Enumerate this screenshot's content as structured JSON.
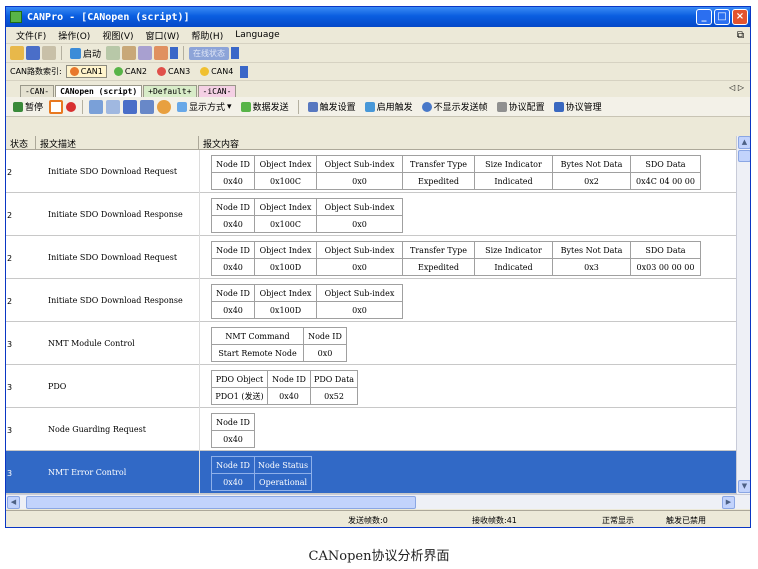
{
  "window": {
    "title": "CANPro - [CANopen (script)]"
  },
  "menu": [
    "文件(F)",
    "操作(O)",
    "视图(V)",
    "窗口(W)",
    "帮助(H)",
    "Language"
  ],
  "toolbar": {
    "start_label": "启动",
    "online_status_label": "在线状态"
  },
  "channels": {
    "label": "CAN路数索引:",
    "items": [
      {
        "name": "CAN1",
        "color": "#e8782c",
        "active": true
      },
      {
        "name": "CAN2",
        "color": "#58b448",
        "active": false
      },
      {
        "name": "CAN3",
        "color": "#e0504a",
        "active": false
      },
      {
        "name": "CAN4",
        "color": "#f0c030",
        "active": false
      }
    ]
  },
  "tabs": [
    {
      "label": "-CAN-",
      "style": "plain"
    },
    {
      "label": "CANopen (script)",
      "style": "active"
    },
    {
      "label": "+Default+",
      "style": "green"
    },
    {
      "label": "-iCAN-",
      "style": "pink"
    }
  ],
  "proto_toolbar": {
    "pause_label": "暂停",
    "display_mode_label": "显示方式",
    "send_data_label": "数据发送",
    "trigger_settings_label": "触发设置",
    "enable_trigger_label": "启用触发",
    "hide_sent_label": "不显示发送帧",
    "protocol_config_label": "协议配置",
    "protocol_manage_label": "协议管理"
  },
  "grid": {
    "headers": [
      "状态",
      "报文描述",
      "报文内容"
    ],
    "rows": [
      {
        "state": "2",
        "desc": "Initiate SDO Download Request",
        "selected": false,
        "cols": [
          "Node ID",
          "Object Index",
          "Object Sub-index",
          "Transfer Type",
          "Size Indicator",
          "Bytes Not Data",
          "SDO Data"
        ],
        "vals": [
          "0x40",
          "0x100C",
          "0x0",
          "Expedited",
          "Indicated",
          "0x2",
          "0x4C 04 00 00"
        ]
      },
      {
        "state": "2",
        "desc": "Initiate SDO Download Response",
        "selected": false,
        "cols": [
          "Node ID",
          "Object Index",
          "Object Sub-index"
        ],
        "vals": [
          "0x40",
          "0x100C",
          "0x0"
        ]
      },
      {
        "state": "2",
        "desc": "Initiate SDO Download Request",
        "selected": false,
        "cols": [
          "Node ID",
          "Object Index",
          "Object Sub-index",
          "Transfer Type",
          "Size Indicator",
          "Bytes Not Data",
          "SDO Data"
        ],
        "vals": [
          "0x40",
          "0x100D",
          "0x0",
          "Expedited",
          "Indicated",
          "0x3",
          "0x03 00 00 00"
        ]
      },
      {
        "state": "2",
        "desc": "Initiate SDO Download Response",
        "selected": false,
        "cols": [
          "Node ID",
          "Object Index",
          "Object Sub-index"
        ],
        "vals": [
          "0x40",
          "0x100D",
          "0x0"
        ]
      },
      {
        "state": "3",
        "desc": "NMT Module Control",
        "selected": false,
        "cols": [
          "NMT Command",
          "Node ID"
        ],
        "vals": [
          "Start Remote Node",
          "0x0"
        ]
      },
      {
        "state": "3",
        "desc": "PDO",
        "selected": false,
        "cols": [
          "PDO Object",
          "Node ID",
          "PDO Data"
        ],
        "vals": [
          "PDO1 (发送)",
          "0x40",
          "0x52"
        ]
      },
      {
        "state": "3",
        "desc": "Node Guarding Request",
        "selected": false,
        "cols": [
          "Node ID"
        ],
        "vals": [
          "0x40"
        ]
      },
      {
        "state": "3",
        "desc": "NMT Error Control",
        "selected": true,
        "cols": [
          "Node ID",
          "Node Status"
        ],
        "vals": [
          "0x40",
          "Operational"
        ]
      }
    ]
  },
  "status": {
    "sent": "发送帧数:0",
    "received": "接收帧数:41",
    "display": "正常显示",
    "trigger": "触发已禁用"
  },
  "caption": "CANopen协议分析界面"
}
